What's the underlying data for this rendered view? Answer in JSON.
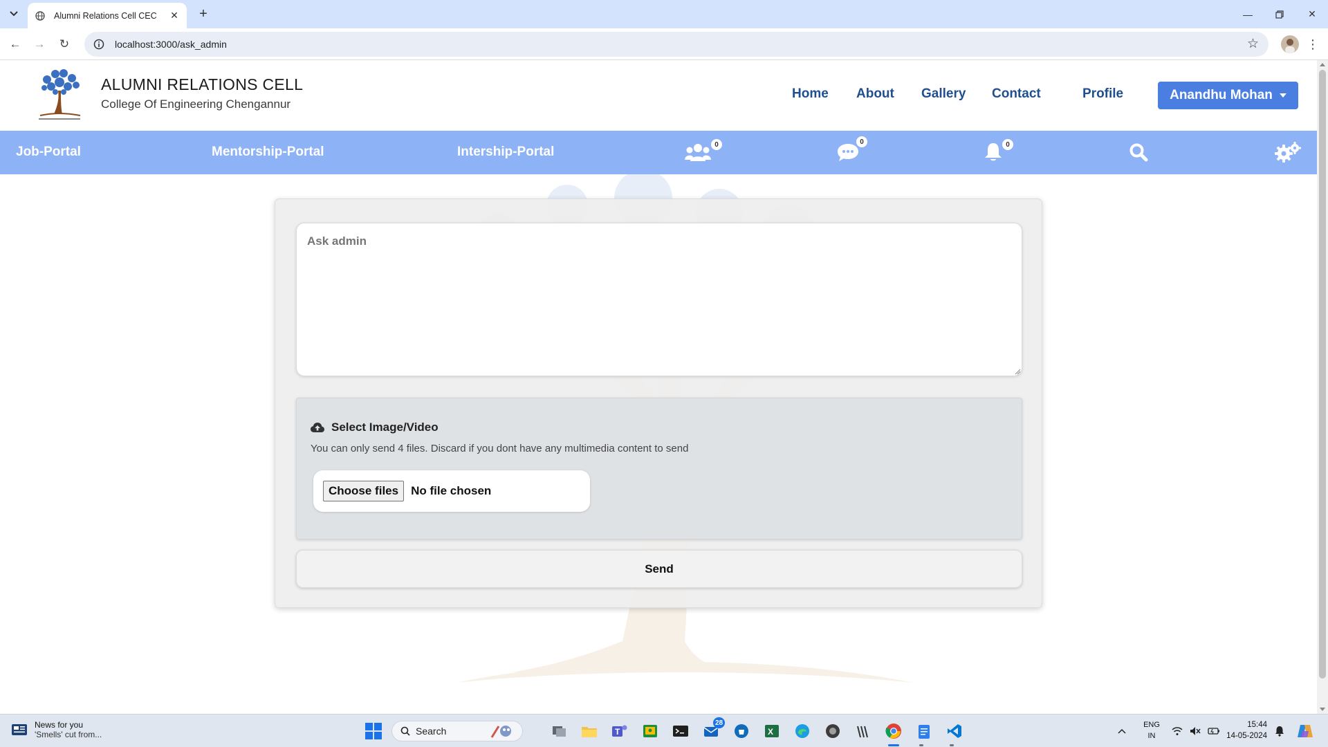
{
  "browser": {
    "tab_title": "Alumni Relations Cell CEC",
    "url": "localhost:3000/ask_admin"
  },
  "site": {
    "brand_title": "ALUMNI RELATIONS CELL",
    "brand_subtitle": "College Of Engineering Chengannur",
    "nav": [
      "Home",
      "About",
      "Gallery",
      "Contact",
      "Profile"
    ],
    "user_name": "Anandhu Mohan",
    "accent_color": "#4a7ee0",
    "band_color": "#8db2f5"
  },
  "portal_bar": {
    "links": [
      "Job-Portal",
      "Mentorship-Portal",
      "Intership-Portal"
    ],
    "friends_count": "0",
    "messages_count": "0",
    "notifications_count": "0",
    "icons": [
      "users-icon",
      "chat-icon",
      "bell-icon",
      "search-icon",
      "settings-icon"
    ]
  },
  "form": {
    "ask_placeholder": "Ask admin",
    "upload_label": "Select Image/Video",
    "upload_note": "You can only send 4 files. Discard if you dont have any multimedia content to send",
    "choose_files": "Choose files",
    "no_file": "No file chosen",
    "send": "Send"
  },
  "taskbar": {
    "news_title": "News for you",
    "news_sub": "'Smells' cut from...",
    "search": "Search",
    "mail_badge": "28",
    "lang_top": "ENG",
    "lang_bottom": "IN",
    "time": "15:44",
    "date": "14-05-2024"
  }
}
